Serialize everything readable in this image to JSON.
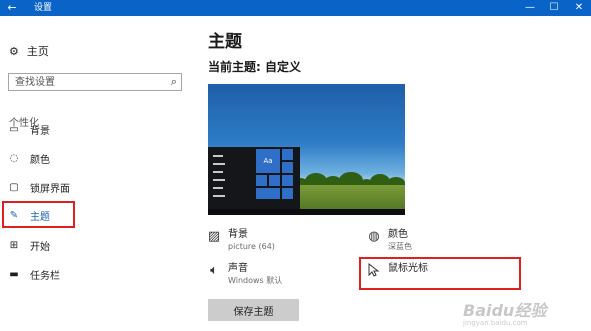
{
  "window": {
    "title": "设置",
    "back_icon": "back-arrow-icon",
    "minimize_icon": "minimize-icon",
    "maximize_icon": "maximize-icon",
    "close_icon": "close-icon"
  },
  "sidebar": {
    "home_label": "主页",
    "search_placeholder": "查找设置",
    "section_label": "个性化",
    "items": [
      {
        "label": "背景",
        "icon": "picture-icon",
        "active": false
      },
      {
        "label": "颜色",
        "icon": "palette-icon",
        "active": false
      },
      {
        "label": "锁屏界面",
        "icon": "lockscreen-icon",
        "active": false
      },
      {
        "label": "主题",
        "icon": "brush-icon",
        "active": true
      },
      {
        "label": "开始",
        "icon": "start-grid-icon",
        "active": false
      },
      {
        "label": "任务栏",
        "icon": "taskbar-icon",
        "active": false
      }
    ]
  },
  "main": {
    "title": "主题",
    "current_theme": "当前主题: 自定义",
    "preview_tile_label": "Aa",
    "options": {
      "background": {
        "title": "背景",
        "subtitle": "picture (64)",
        "icon": "picture-icon"
      },
      "color": {
        "title": "颜色",
        "subtitle": "深蓝色",
        "icon": "palette-icon"
      },
      "sound": {
        "title": "声音",
        "subtitle": "Windows 默认",
        "icon": "speaker-icon"
      },
      "cursor": {
        "title": "鼠标光标",
        "icon": "cursor-icon"
      }
    },
    "save_button": "保存主题"
  },
  "watermark": {
    "text": "Baidu经验",
    "sub": "jingyan.baidu.com"
  },
  "colors": {
    "titlebar": "#0a64c8",
    "accent": "#1a5fb4",
    "highlight": "#e02020",
    "tile": "#2f6fc8"
  }
}
